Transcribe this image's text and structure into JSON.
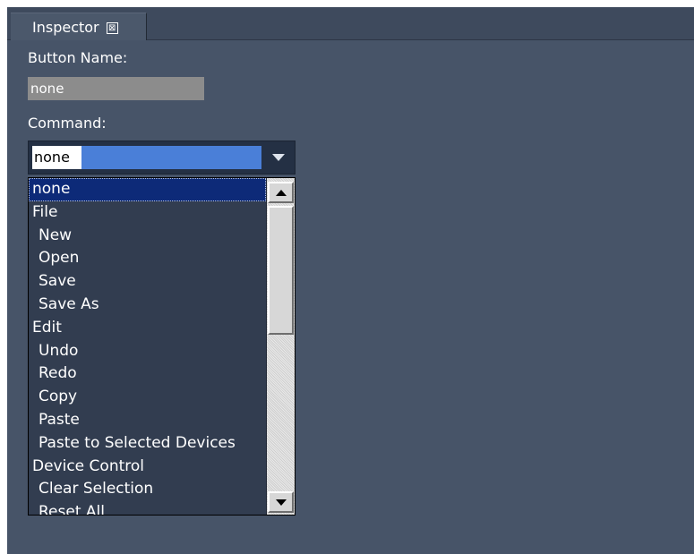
{
  "tab": {
    "title": "Inspector",
    "close_glyph": "⊠"
  },
  "button_name": {
    "label": "Button Name:",
    "value": "none"
  },
  "command": {
    "label": "Command:",
    "value": "none",
    "options": [
      {
        "label": "none",
        "indent": false,
        "selected": true
      },
      {
        "label": "File",
        "indent": false
      },
      {
        "label": "New",
        "indent": true
      },
      {
        "label": "Open",
        "indent": true
      },
      {
        "label": "Save",
        "indent": true
      },
      {
        "label": "Save As",
        "indent": true
      },
      {
        "label": "Edit",
        "indent": false
      },
      {
        "label": "Undo",
        "indent": true
      },
      {
        "label": "Redo",
        "indent": true
      },
      {
        "label": "Copy",
        "indent": true
      },
      {
        "label": "Paste",
        "indent": true
      },
      {
        "label": "Paste to Selected Devices",
        "indent": true
      },
      {
        "label": "Device Control",
        "indent": false
      },
      {
        "label": "Clear Selection",
        "indent": true
      },
      {
        "label": "Reset All",
        "indent": true
      }
    ]
  },
  "icons": {
    "dropdown": "chevron-down-icon",
    "scroll_up": "scroll-up-arrow-icon",
    "scroll_down": "scroll-down-arrow-icon"
  },
  "colors": {
    "panel": "#475468",
    "selection": "#0d2a78",
    "text_highlight": "#4a7fd8"
  }
}
